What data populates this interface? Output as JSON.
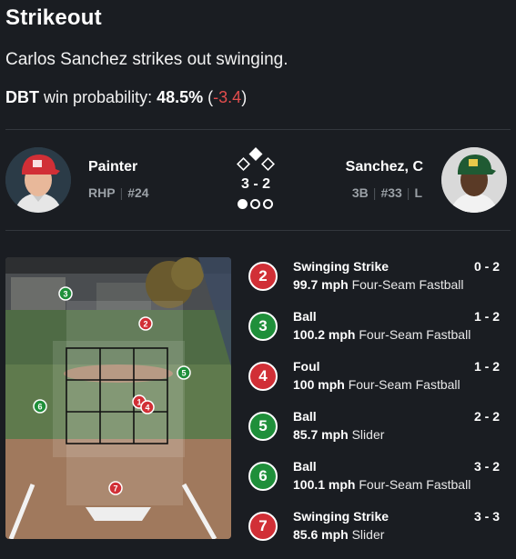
{
  "play": {
    "title": "Strikeout",
    "description": "Carlos Sanchez strikes out swinging.",
    "win_prob": {
      "team": "DBT",
      "label": "win probability:",
      "value": "48.5%",
      "delta_open": "(",
      "delta": "-3.4",
      "delta_close": ")"
    }
  },
  "pitcher": {
    "name": "Painter",
    "position": "RHP",
    "number": "#24"
  },
  "batter": {
    "name": "Sanchez, C",
    "position": "3B",
    "number": "#33",
    "bats": "L"
  },
  "situation": {
    "count": "3 - 2",
    "bases_occupied": [
      "second"
    ],
    "outs": 1
  },
  "zone_markers": [
    {
      "num": "3",
      "result": "ball"
    },
    {
      "num": "2",
      "result": "strike"
    },
    {
      "num": "5",
      "result": "ball"
    },
    {
      "num": "6",
      "result": "ball"
    },
    {
      "num": "1",
      "result": "strike"
    },
    {
      "num": "4",
      "result": "strike"
    },
    {
      "num": "7",
      "result": "strike"
    }
  ],
  "pitches": [
    {
      "num": "2",
      "result": "strike",
      "type": "Swinging Strike",
      "count": "0 - 2",
      "speed": "99.7 mph",
      "pitch": "Four-Seam Fastball"
    },
    {
      "num": "3",
      "result": "ball",
      "type": "Ball",
      "count": "1 - 2",
      "speed": "100.2 mph",
      "pitch": "Four-Seam Fastball"
    },
    {
      "num": "4",
      "result": "strike",
      "type": "Foul",
      "count": "1 - 2",
      "speed": "100 mph",
      "pitch": "Four-Seam Fastball"
    },
    {
      "num": "5",
      "result": "ball",
      "type": "Ball",
      "count": "2 - 2",
      "speed": "85.7 mph",
      "pitch": "Slider"
    },
    {
      "num": "6",
      "result": "ball",
      "type": "Ball",
      "count": "3 - 2",
      "speed": "100.1 mph",
      "pitch": "Four-Seam Fastball"
    },
    {
      "num": "7",
      "result": "strike",
      "type": "Swinging Strike",
      "count": "3 - 3",
      "speed": "85.6 mph",
      "pitch": "Slider"
    }
  ],
  "colors": {
    "strike": "#d12f36",
    "ball": "#1f8f3a",
    "negative_delta": "#e24d4d"
  }
}
